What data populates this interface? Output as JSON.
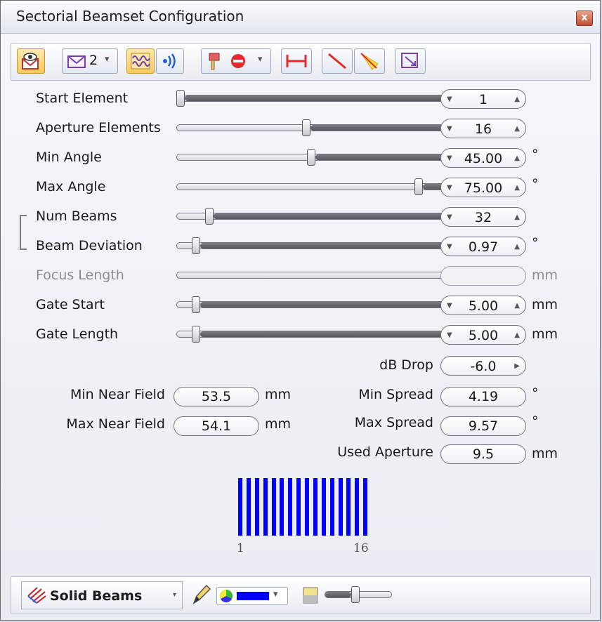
{
  "window": {
    "title": "Sectorial Beamset Configuration",
    "close_label": "x"
  },
  "toolbar": {
    "view_count": "2",
    "dropdown_arrow": "▾"
  },
  "params": [
    {
      "label": "Start Element",
      "value": "1",
      "unit": "",
      "position": 0.0,
      "enabled": true
    },
    {
      "label": "Aperture Elements",
      "value": "16",
      "unit": "",
      "position": 0.48,
      "enabled": true
    },
    {
      "label": "Min Angle",
      "value": "45.00",
      "unit": "°",
      "position": 0.5,
      "enabled": true
    },
    {
      "label": "Max Angle",
      "value": "75.00",
      "unit": "°",
      "position": 0.91,
      "enabled": true
    },
    {
      "label": "Num Beams",
      "value": "32",
      "unit": "",
      "position": 0.11,
      "enabled": true
    },
    {
      "label": "Beam Deviation",
      "value": "0.97",
      "unit": "°",
      "position": 0.06,
      "enabled": true
    },
    {
      "label": "Focus Length",
      "value": "",
      "unit": "mm",
      "position": null,
      "enabled": false
    },
    {
      "label": "Gate Start",
      "value": "5.00",
      "unit": "mm",
      "position": 0.06,
      "enabled": true
    },
    {
      "label": "Gate Length",
      "value": "5.00",
      "unit": "mm",
      "position": 0.06,
      "enabled": true
    }
  ],
  "db_drop": {
    "label": "dB Drop",
    "value": "-6.0"
  },
  "near_field": {
    "min_label": "Min Near Field",
    "min_value": "53.5",
    "min_unit": "mm",
    "max_label": "Max Near Field",
    "max_value": "54.1",
    "max_unit": "mm"
  },
  "spread": {
    "min_label": "Min Spread",
    "min_value": "4.19",
    "min_unit": "°",
    "max_label": "Max Spread",
    "max_value": "9.57",
    "max_unit": "°"
  },
  "used_aperture": {
    "label": "Used Aperture",
    "value": "9.5",
    "unit": "mm"
  },
  "elements": {
    "first_label": "1",
    "last_label": "16",
    "count": 16,
    "color": "#0000ff"
  },
  "bottom": {
    "mode_label": "Solid Beams",
    "beam_color": "#0000ff",
    "opacity_level": 0.45
  }
}
